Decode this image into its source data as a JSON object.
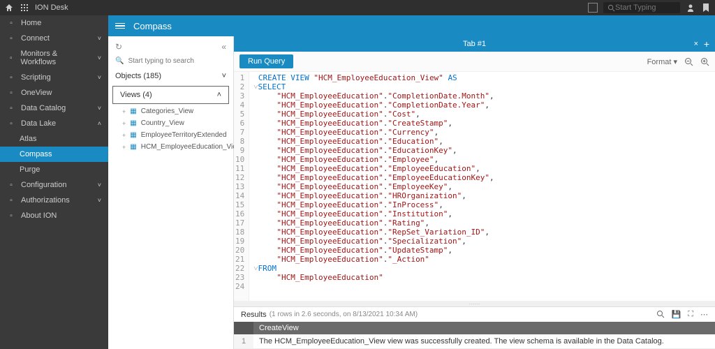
{
  "topbar": {
    "app_name": "ION Desk",
    "search_placeholder": "Start Typing"
  },
  "sidebar": {
    "items": [
      {
        "label": "Home",
        "icon": "home",
        "expandable": false
      },
      {
        "label": "Connect",
        "icon": "connect",
        "expandable": true
      },
      {
        "label": "Monitors & Workflows",
        "icon": "monitors",
        "expandable": true
      },
      {
        "label": "Scripting",
        "icon": "scripting",
        "expandable": true
      },
      {
        "label": "OneView",
        "icon": "oneview",
        "expandable": false
      },
      {
        "label": "Data Catalog",
        "icon": "catalog",
        "expandable": true
      },
      {
        "label": "Data Lake",
        "icon": "datalake",
        "expandable": true,
        "expanded": true,
        "children": [
          {
            "label": "Atlas"
          },
          {
            "label": "Compass",
            "active": true
          },
          {
            "label": "Purge"
          }
        ]
      },
      {
        "label": "Configuration",
        "icon": "config",
        "expandable": true
      },
      {
        "label": "Authorizations",
        "icon": "auth",
        "expandable": true
      },
      {
        "label": "About ION",
        "icon": "about",
        "expandable": false
      }
    ]
  },
  "page_title": "Compass",
  "tree": {
    "search_placeholder": "Start typing to search",
    "sections": [
      {
        "label": "Objects (185)",
        "expanded": false
      },
      {
        "label": "Views (4)",
        "expanded": true,
        "boxed": true
      }
    ],
    "views": [
      "Categories_View",
      "Country_View",
      "EmployeeTerritoryExtended",
      "HCM_EmployeeEducation_View"
    ]
  },
  "tabs": {
    "active": "Tab #1"
  },
  "toolbar": {
    "run_label": "Run Query",
    "format_label": "Format"
  },
  "code": {
    "lines": [
      {
        "n": 1,
        "t": "CREATE VIEW \"HCM_EmployeeEducation_View\" AS",
        "kw": [
          "CREATE",
          "VIEW",
          "AS"
        ]
      },
      {
        "n": 2,
        "t": "SELECT",
        "kw": [
          "SELECT"
        ],
        "fold": true
      },
      {
        "n": 3,
        "t": "    \"HCM_EmployeeEducation\".\"CompletionDate.Month\","
      },
      {
        "n": 4,
        "t": "    \"HCM_EmployeeEducation\".\"CompletionDate.Year\","
      },
      {
        "n": 5,
        "t": "    \"HCM_EmployeeEducation\".\"Cost\","
      },
      {
        "n": 6,
        "t": "    \"HCM_EmployeeEducation\".\"CreateStamp\","
      },
      {
        "n": 7,
        "t": "    \"HCM_EmployeeEducation\".\"Currency\","
      },
      {
        "n": 8,
        "t": "    \"HCM_EmployeeEducation\".\"Education\","
      },
      {
        "n": 9,
        "t": "    \"HCM_EmployeeEducation\".\"EducationKey\","
      },
      {
        "n": 10,
        "t": "    \"HCM_EmployeeEducation\".\"Employee\","
      },
      {
        "n": 11,
        "t": "    \"HCM_EmployeeEducation\".\"EmployeeEducation\","
      },
      {
        "n": 12,
        "t": "    \"HCM_EmployeeEducation\".\"EmployeeEducationKey\","
      },
      {
        "n": 13,
        "t": "    \"HCM_EmployeeEducation\".\"EmployeeKey\","
      },
      {
        "n": 14,
        "t": "    \"HCM_EmployeeEducation\".\"HROrganization\","
      },
      {
        "n": 15,
        "t": "    \"HCM_EmployeeEducation\".\"InProcess\","
      },
      {
        "n": 16,
        "t": "    \"HCM_EmployeeEducation\".\"Institution\","
      },
      {
        "n": 17,
        "t": "    \"HCM_EmployeeEducation\".\"Rating\","
      },
      {
        "n": 18,
        "t": "    \"HCM_EmployeeEducation\".\"RepSet_Variation_ID\","
      },
      {
        "n": 19,
        "t": "    \"HCM_EmployeeEducation\".\"Specialization\","
      },
      {
        "n": 20,
        "t": "    \"HCM_EmployeeEducation\".\"UpdateStamp\","
      },
      {
        "n": 21,
        "t": "    \"HCM_EmployeeEducation\".\"_Action\""
      },
      {
        "n": 22,
        "t": "FROM",
        "kw": [
          "FROM"
        ],
        "fold": true
      },
      {
        "n": 23,
        "t": "    \"HCM_EmployeeEducation\""
      },
      {
        "n": 24,
        "t": ""
      }
    ]
  },
  "results": {
    "label": "Results",
    "meta": "(1 rows in 2.6 seconds, on 8/13/2021 10:34 AM)",
    "columns": [
      "CreateView"
    ],
    "rows": [
      {
        "n": 1,
        "cells": [
          "The HCM_EmployeeEducation_View view was successfully created. The view schema is available in the Data Catalog."
        ]
      }
    ]
  }
}
